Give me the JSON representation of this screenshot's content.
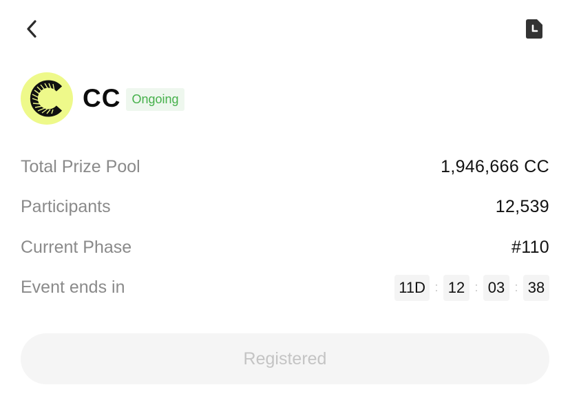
{
  "icons": {
    "back": "chevron-left-icon",
    "document": "document-clock-icon",
    "logo": "cc-logo-icon"
  },
  "colors": {
    "avatar_bg": "#eef98a",
    "badge_bg": "#eef7ee",
    "badge_text": "#45b04a",
    "label_text": "#8a8a8a",
    "value_text": "#111111",
    "button_bg": "#f5f5f5",
    "button_text": "#c4c4c4"
  },
  "token": {
    "name": "CC",
    "status": "Ongoing"
  },
  "info": {
    "prize_pool_label": "Total Prize Pool",
    "prize_pool_value": "1,946,666 CC",
    "participants_label": "Participants",
    "participants_value": "12,539",
    "phase_label": "Current Phase",
    "phase_value": "#110",
    "ends_label": "Event ends in"
  },
  "countdown": {
    "days": "11D",
    "hours": "12",
    "minutes": "03",
    "seconds": "38",
    "separator": ":"
  },
  "action": {
    "button_label": "Registered"
  }
}
